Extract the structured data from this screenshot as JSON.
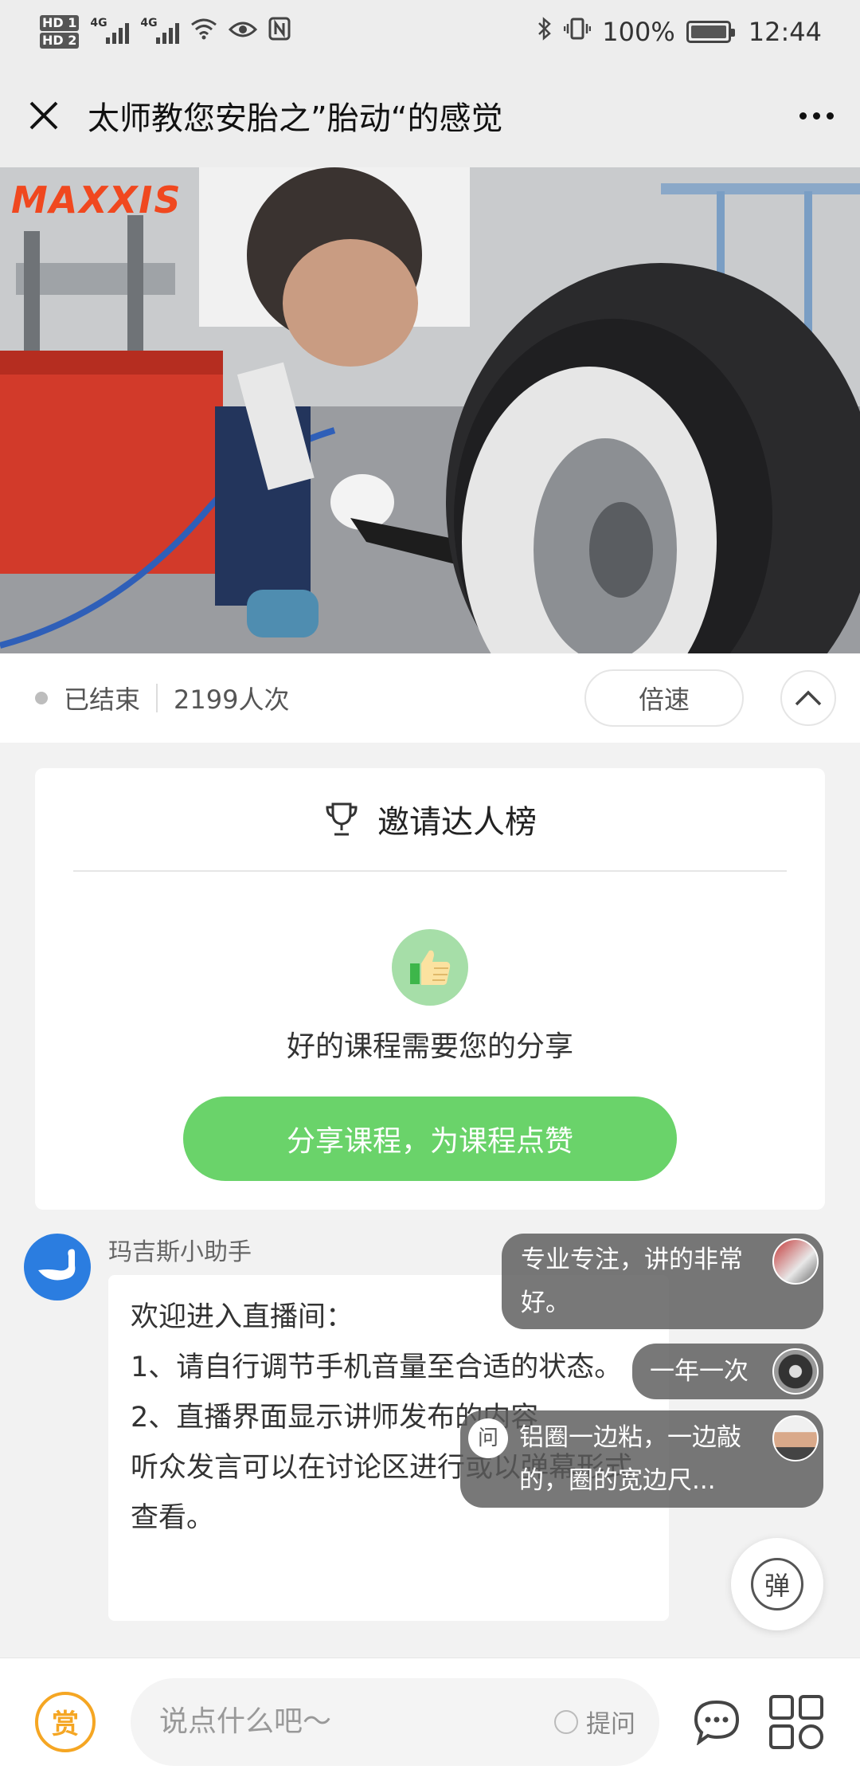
{
  "status_bar": {
    "sim1": "HD 1",
    "sim2": "HD 2",
    "net1": "4G",
    "net2": "4G",
    "battery": "100%",
    "battery_level": 1.0,
    "time": "12:44"
  },
  "header": {
    "title": "太师教您安胎之”胎动“的感觉",
    "close_icon": "close-icon",
    "more_icon": "more-icon"
  },
  "video": {
    "brand_text": "MAXXIS",
    "brand_color": "#f0481f"
  },
  "info": {
    "status": "已结束",
    "views": "2199人次",
    "speed_label": "倍速"
  },
  "leaderboard": {
    "title": "邀请达人榜",
    "subtitle": "好的课程需要您的分享",
    "share_button": "分享课程，为课程点赞",
    "accent_color": "#6ad36a"
  },
  "chat": {
    "sender": "玛吉斯小助手",
    "message": "欢迎进入直播间：\n1、请自行调节手机音量至合适的状态。\n2、直播界面显示讲师发布的内容\n听众发言可以在讨论区进行或以弹幕形式查看。"
  },
  "danmaku": [
    {
      "text": "专业专注，讲的非常好。"
    },
    {
      "text": "一年一次"
    },
    {
      "text": "铝圈一边粘，一边敲的，圈的宽边尺...",
      "tag": "问"
    }
  ],
  "danmu_toggle": "弹",
  "bottom": {
    "reward_label": "赏",
    "input_placeholder": "说点什么吧～",
    "ask_label": "提问"
  }
}
